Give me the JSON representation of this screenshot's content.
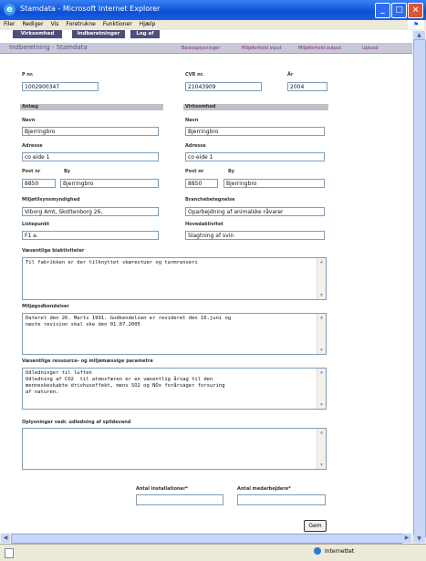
{
  "window": {
    "title": "Stamdata - Microsoft Internet Explorer"
  },
  "menu": [
    "Filer",
    "Rediger",
    "Vis",
    "Foretrukne",
    "Funktioner",
    "Hjælp"
  ],
  "nav": {
    "tabs": [
      "Virksomhed",
      "Indberetninger",
      "Log af"
    ]
  },
  "header": {
    "title": "Indberetning - Stamdata",
    "links": [
      "Basisoplysninger",
      "Miljøforhold input",
      "Miljøforhold output",
      "Upload"
    ]
  },
  "form": {
    "pnr": {
      "label": "P nr.",
      "value": "1002900347"
    },
    "cvr": {
      "label": "CVR nr.",
      "value": "21043909"
    },
    "aar": {
      "label": "År",
      "value": "2004"
    },
    "anlaeg": {
      "heading": "Anlæg",
      "navn": {
        "label": "Navn",
        "value": "Bjerringbro"
      },
      "adresse": {
        "label": "Adresse",
        "value": "co eide 1"
      },
      "postnr": {
        "label": "Post nr",
        "value": "8850"
      },
      "by": {
        "label": "By",
        "value": "Bjerringbro"
      }
    },
    "virksomhed": {
      "heading": "Virksomhed",
      "navn": {
        "label": "Navn",
        "value": "Bjerringbro"
      },
      "adresse": {
        "label": "Adresse",
        "value": "co eide 1"
      },
      "postnr": {
        "label": "Post nr",
        "value": "8850"
      },
      "by": {
        "label": "By",
        "value": "Bjerringbro"
      }
    },
    "myndighed": {
      "label": "Miljøtilsynsmyndighed",
      "value": "Viborg Amt, Skottenborg 26,"
    },
    "branche": {
      "label": "Branchebetegnelse",
      "value": "Oparbejdning af animalske råvarer"
    },
    "listepunkt": {
      "label": "Listepunkt",
      "value": "F1 a."
    },
    "hovedaktivitet": {
      "label": "Hovedaktivitet",
      "value": "Slagtning af svin"
    },
    "bi_aktiviteter": {
      "label": "Væsentlige biaktiviteter",
      "lines": [
        "Til fabrikken er der tilknyttet skærestuer og tarmrenseri"
      ]
    },
    "miljoegodkendelser": {
      "label": "Miljøgodkendelser",
      "lines": [
        "Dateret den 26. Marts 1991. Godkendelsen er revideret den 16.juni og",
        "næste revision skal ske den 01.07.2005"
      ]
    },
    "ressource": {
      "label": "Væsentlige ressource- og miljømæssige parametre",
      "lines": [
        "Udledninger til luften",
        "Udledning af CO2  til atmosfæren er en væsentlig årsag til den",
        "menneskeskabte drivhuseffekt, mens SO2 og NOx forårsager forsuring",
        "af naturen."
      ]
    },
    "spildevand": {
      "label": "Oplysninger vedr. udledning af spildevand",
      "lines": []
    },
    "installationer": {
      "label": "Antal installationer*",
      "value": ""
    },
    "medarbejdere": {
      "label": "Antal medarbejdere*",
      "value": ""
    },
    "save_label": "Gem"
  },
  "status": {
    "zone": "Internettet"
  }
}
